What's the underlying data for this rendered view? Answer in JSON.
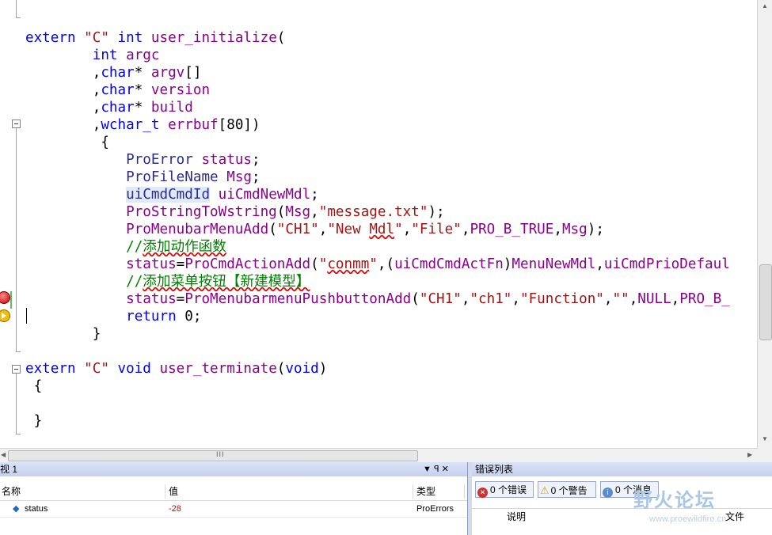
{
  "code": {
    "lines": [
      [
        {
          "t": "extern ",
          "c": "kw"
        },
        {
          "t": "\"C\"",
          "c": "str"
        },
        {
          "t": " ",
          "c": "pl"
        },
        {
          "t": "int",
          "c": "kw"
        },
        {
          "t": " ",
          "c": "pl"
        },
        {
          "t": "user_initialize",
          "c": "fn"
        },
        {
          "t": "(",
          "c": "pl"
        }
      ],
      [
        {
          "t": "        ",
          "c": "pl"
        },
        {
          "t": "int",
          "c": "kw"
        },
        {
          "t": " argc",
          "c": "fn"
        }
      ],
      [
        {
          "t": "        ,",
          "c": "pl"
        },
        {
          "t": "char",
          "c": "kw"
        },
        {
          "t": "* ",
          "c": "pl"
        },
        {
          "t": "argv",
          "c": "fn"
        },
        {
          "t": "[]",
          "c": "pl"
        }
      ],
      [
        {
          "t": "        ,",
          "c": "pl"
        },
        {
          "t": "char",
          "c": "kw"
        },
        {
          "t": "* ",
          "c": "pl"
        },
        {
          "t": "version",
          "c": "fn"
        }
      ],
      [
        {
          "t": "        ,",
          "c": "pl"
        },
        {
          "t": "char",
          "c": "kw"
        },
        {
          "t": "* ",
          "c": "pl"
        },
        {
          "t": "build",
          "c": "fn"
        }
      ],
      [
        {
          "t": "        ,",
          "c": "pl"
        },
        {
          "t": "wchar_t",
          "c": "kw"
        },
        {
          "t": " ",
          "c": "pl"
        },
        {
          "t": "errbuf",
          "c": "fn"
        },
        {
          "t": "[80])",
          "c": "pl"
        }
      ],
      [
        {
          "t": "         {",
          "c": "pl"
        }
      ],
      [
        {
          "t": "            ",
          "c": "pl"
        },
        {
          "t": "ProError",
          "c": "ty"
        },
        {
          "t": " ",
          "c": "pl"
        },
        {
          "t": "status",
          "c": "fn"
        },
        {
          "t": ";",
          "c": "pl"
        }
      ],
      [
        {
          "t": "            ",
          "c": "pl"
        },
        {
          "t": "ProFileName",
          "c": "ty"
        },
        {
          "t": " ",
          "c": "pl"
        },
        {
          "t": "Msg",
          "c": "fn"
        },
        {
          "t": ";",
          "c": "pl"
        }
      ],
      [
        {
          "t": "            ",
          "c": "pl"
        },
        {
          "t": "uiCmdCmdId",
          "c": "ty hl"
        },
        {
          "t": " ",
          "c": "pl"
        },
        {
          "t": "uiCmdNewMdl",
          "c": "fn"
        },
        {
          "t": ";",
          "c": "pl"
        }
      ],
      [
        {
          "t": "            ",
          "c": "pl"
        },
        {
          "t": "ProStringToWstring",
          "c": "fn"
        },
        {
          "t": "(",
          "c": "pl"
        },
        {
          "t": "Msg",
          "c": "fn"
        },
        {
          "t": ",",
          "c": "pl"
        },
        {
          "t": "\"message.txt\"",
          "c": "str"
        },
        {
          "t": ");",
          "c": "pl"
        }
      ],
      [
        {
          "t": "            ",
          "c": "pl"
        },
        {
          "t": "ProMenubarMenuAdd",
          "c": "fn"
        },
        {
          "t": "(",
          "c": "pl"
        },
        {
          "t": "\"CH1\"",
          "c": "str"
        },
        {
          "t": ",",
          "c": "pl"
        },
        {
          "t": "\"New ",
          "c": "str"
        },
        {
          "t": "Mdl",
          "c": "str sq"
        },
        {
          "t": "\"",
          "c": "str"
        },
        {
          "t": ",",
          "c": "pl"
        },
        {
          "t": "\"File\"",
          "c": "str"
        },
        {
          "t": ",",
          "c": "pl"
        },
        {
          "t": "PRO_B_TRUE",
          "c": "fn"
        },
        {
          "t": ",",
          "c": "pl"
        },
        {
          "t": "Msg",
          "c": "fn"
        },
        {
          "t": ");",
          "c": "pl"
        }
      ],
      [
        {
          "t": "            ",
          "c": "pl"
        },
        {
          "t": "//",
          "c": "cm"
        },
        {
          "t": "添加动作函数",
          "c": "cm sq"
        }
      ],
      [
        {
          "t": "            ",
          "c": "pl"
        },
        {
          "t": "status",
          "c": "fn"
        },
        {
          "t": "=",
          "c": "pl"
        },
        {
          "t": "ProCmdActionAdd",
          "c": "fn"
        },
        {
          "t": "(",
          "c": "pl"
        },
        {
          "t": "\"",
          "c": "str"
        },
        {
          "t": "conmm",
          "c": "str sq"
        },
        {
          "t": "\"",
          "c": "str"
        },
        {
          "t": ",(",
          "c": "pl"
        },
        {
          "t": "uiCmdCmdActFn",
          "c": "fn"
        },
        {
          "t": ")",
          "c": "pl"
        },
        {
          "t": "MenuNewMdl",
          "c": "fn"
        },
        {
          "t": ",",
          "c": "pl"
        },
        {
          "t": "uiCmdPrioDefaul",
          "c": "fn"
        }
      ],
      [
        {
          "t": "            ",
          "c": "pl"
        },
        {
          "t": "//",
          "c": "cm"
        },
        {
          "t": "添加菜单按钮【新建模型】",
          "c": "cm sq"
        }
      ],
      [
        {
          "t": "            ",
          "c": "pl"
        },
        {
          "t": "status",
          "c": "fn"
        },
        {
          "t": "=",
          "c": "pl"
        },
        {
          "t": "ProMenubarmenuPushbuttonAdd",
          "c": "fn"
        },
        {
          "t": "(",
          "c": "pl"
        },
        {
          "t": "\"CH1\"",
          "c": "str"
        },
        {
          "t": ",",
          "c": "pl"
        },
        {
          "t": "\"ch1\"",
          "c": "str"
        },
        {
          "t": ",",
          "c": "pl"
        },
        {
          "t": "\"Function\"",
          "c": "str"
        },
        {
          "t": ",",
          "c": "pl"
        },
        {
          "t": "\"\"",
          "c": "str"
        },
        {
          "t": ",",
          "c": "pl"
        },
        {
          "t": "NULL",
          "c": "fn"
        },
        {
          "t": ",",
          "c": "pl"
        },
        {
          "t": "PRO_B_",
          "c": "fn"
        }
      ],
      [
        {
          "t": "            ",
          "c": "pl"
        },
        {
          "t": "return",
          "c": "kw"
        },
        {
          "t": " 0;",
          "c": "pl"
        }
      ],
      [
        {
          "t": "        }",
          "c": "pl"
        }
      ],
      [
        {
          "t": "",
          "c": "pl"
        }
      ],
      [
        {
          "t": "extern ",
          "c": "kw"
        },
        {
          "t": "\"C\"",
          "c": "str"
        },
        {
          "t": " ",
          "c": "pl"
        },
        {
          "t": "void",
          "c": "kw"
        },
        {
          "t": " ",
          "c": "pl"
        },
        {
          "t": "user_terminate",
          "c": "fn"
        },
        {
          "t": "(",
          "c": "pl"
        },
        {
          "t": "void",
          "c": "kw"
        },
        {
          "t": ")",
          "c": "pl"
        }
      ],
      [
        {
          "t": " {",
          "c": "pl"
        }
      ],
      [
        {
          "t": "",
          "c": "pl"
        }
      ],
      [
        {
          "t": " }",
          "c": "pl"
        }
      ]
    ]
  },
  "hscroll": {
    "grip": "III"
  },
  "watch": {
    "title": "视 1",
    "pin": "▼ ꟼ ✕",
    "columns": {
      "name": "名称",
      "value": "值",
      "type": "类型"
    },
    "row": {
      "name": "status",
      "value": "-28",
      "type": "ProErrors"
    }
  },
  "errors": {
    "title": "错误列表",
    "errors_btn": "0 个错误",
    "warnings_btn": "0 个警告",
    "messages_btn": "0 个消息",
    "col_desc": "说明",
    "col_file": "文件"
  },
  "watermark": {
    "text": "野火论坛",
    "url": "www.proewildfire.cn"
  },
  "colors": {
    "keyword": "#0000ff",
    "type": "#2b2b91",
    "identifier": "#8b008b",
    "string": "#a31515",
    "comment": "#008000",
    "value_error": "#e00000"
  }
}
